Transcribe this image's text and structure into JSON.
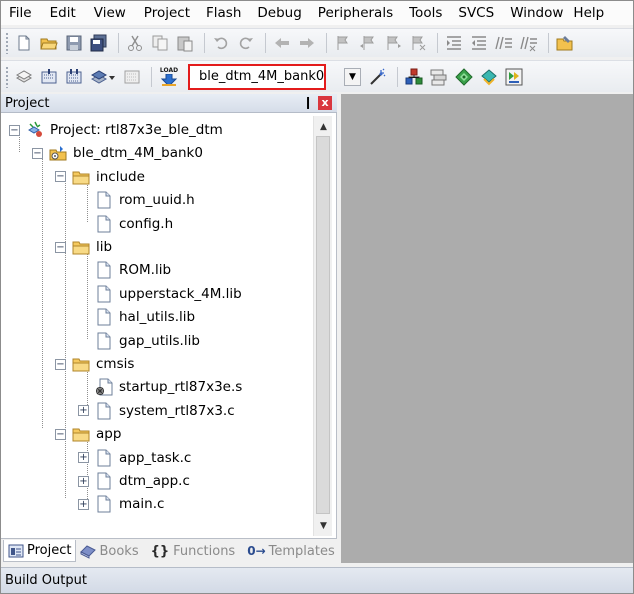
{
  "menu": [
    "File",
    "Edit",
    "View",
    "Project",
    "Flash",
    "Debug",
    "Peripherals",
    "Tools",
    "SVCS",
    "Window",
    "Help"
  ],
  "toolbar2": {
    "load_label": "LOAD",
    "target_name": "ble_dtm_4M_bank0"
  },
  "project_panel": {
    "title": "Project",
    "pin": "❙",
    "close": "x",
    "tree": [
      {
        "label": "Project: rtl87x3e_ble_dtm",
        "level": 0,
        "kind": "project",
        "expander": "−"
      },
      {
        "label": "ble_dtm_4M_bank0",
        "level": 1,
        "kind": "target",
        "expander": "−"
      },
      {
        "label": "include",
        "level": 2,
        "kind": "folder",
        "expander": "−"
      },
      {
        "label": "rom_uuid.h",
        "level": 3,
        "kind": "file",
        "expander": ""
      },
      {
        "label": "config.h",
        "level": 3,
        "kind": "file",
        "expander": ""
      },
      {
        "label": "lib",
        "level": 2,
        "kind": "folder",
        "expander": "−"
      },
      {
        "label": "ROM.lib",
        "level": 3,
        "kind": "file",
        "expander": ""
      },
      {
        "label": "upperstack_4M.lib",
        "level": 3,
        "kind": "file",
        "expander": ""
      },
      {
        "label": "hal_utils.lib",
        "level": 3,
        "kind": "file",
        "expander": ""
      },
      {
        "label": "gap_utils.lib",
        "level": 3,
        "kind": "file",
        "expander": ""
      },
      {
        "label": "cmsis",
        "level": 2,
        "kind": "folder",
        "expander": "−"
      },
      {
        "label": "startup_rtl87x3e.s",
        "level": 3,
        "kind": "asm",
        "expander": ""
      },
      {
        "label": "system_rtl87x3.c",
        "level": 3,
        "kind": "file",
        "expander": "+"
      },
      {
        "label": "app",
        "level": 2,
        "kind": "folder",
        "expander": "−"
      },
      {
        "label": "app_task.c",
        "level": 3,
        "kind": "file",
        "expander": "+"
      },
      {
        "label": "dtm_app.c",
        "level": 3,
        "kind": "file",
        "expander": "+"
      },
      {
        "label": "main.c",
        "level": 3,
        "kind": "file",
        "expander": "+"
      }
    ],
    "scroll_up": "▲",
    "scroll_down": "▼",
    "tabs": [
      {
        "label": "Project",
        "icon": "project-tab-icon",
        "active": true
      },
      {
        "label": "Books",
        "icon": "books-icon",
        "active": false
      },
      {
        "label": "Functions",
        "icon": "functions-icon",
        "glyph": "{}",
        "active": false
      },
      {
        "label": "Templates",
        "icon": "templates-icon",
        "glyph": "0→",
        "active": false
      }
    ]
  },
  "build_output": {
    "title": "Build Output"
  },
  "colors": {
    "highlight_box": "#e31b1b",
    "editor_bg": "#acacac",
    "close_btn": "#d9363e"
  }
}
